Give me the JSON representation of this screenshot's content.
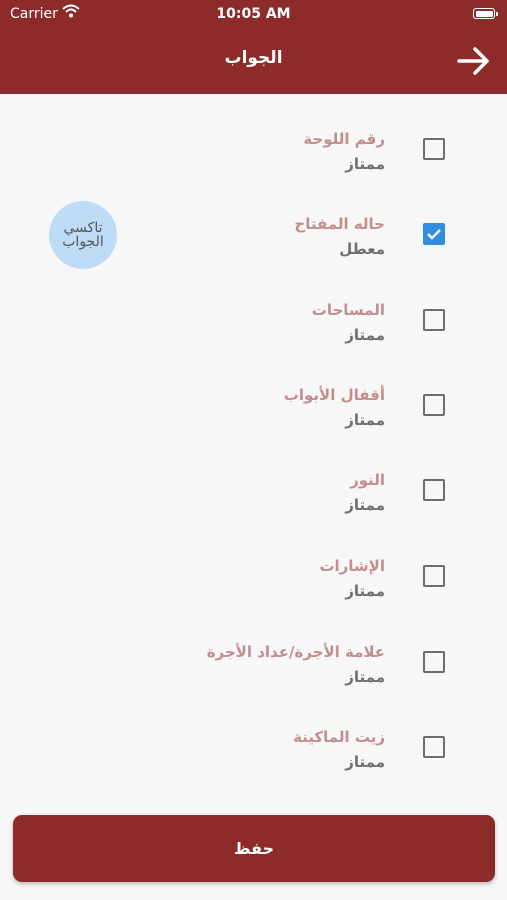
{
  "status_bar": {
    "carrier": "Carrier",
    "time": "10:05 AM"
  },
  "nav": {
    "title": "الجواب"
  },
  "items": [
    {
      "label": "رقم اللوحة",
      "value": "ممتاز",
      "checked": false
    },
    {
      "label": "حاله المفتاح",
      "value": "معطل",
      "checked": true
    },
    {
      "label": "المساحات",
      "value": "ممتاز",
      "checked": false
    },
    {
      "label": "أقفال الأبواب",
      "value": "ممتاز",
      "checked": false
    },
    {
      "label": "النور",
      "value": "ممتاز",
      "checked": false
    },
    {
      "label": "الإشارات",
      "value": "ممتاز",
      "checked": false
    },
    {
      "label": "علامة الأجرة/عداد الأجرة",
      "value": "ممتاز",
      "checked": false
    },
    {
      "label": "زيت الماكينة",
      "value": "ممتاز",
      "checked": false
    }
  ],
  "watermark": {
    "line1": "تاكسي",
    "line2": "الجواب"
  },
  "save_button": {
    "label": "حفظ"
  },
  "colors": {
    "brand": "#8d2a2a",
    "checked": "#2f8ee0",
    "label": "#c38e8e"
  },
  "icons": {
    "back": "arrow-right-icon",
    "check": "check-icon",
    "wifi": "wifi-icon",
    "battery": "battery-icon"
  }
}
